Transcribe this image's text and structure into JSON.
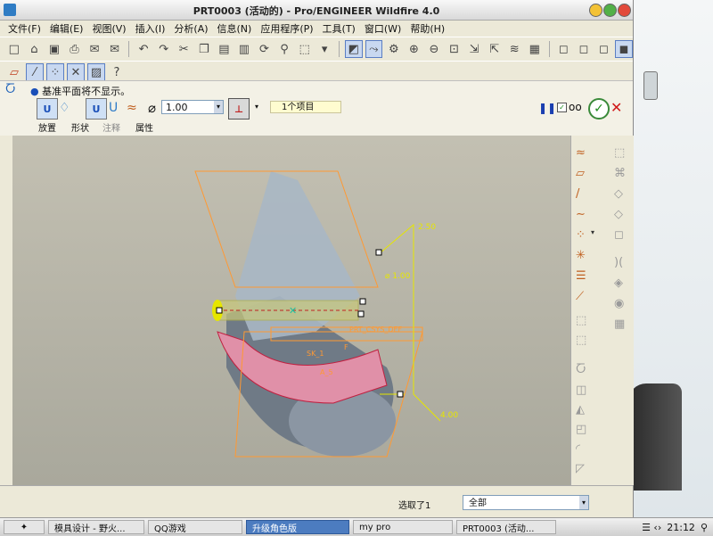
{
  "window": {
    "title": "PRT0003 (活动的) - Pro/ENGINEER Wildfire 4.0"
  },
  "menu": [
    "文件(F)",
    "编辑(E)",
    "视图(V)",
    "插入(I)",
    "分析(A)",
    "信息(N)",
    "应用程序(P)",
    "工具(T)",
    "窗口(W)",
    "帮助(H)"
  ],
  "dashboard": {
    "message": "基准平面将不显示。",
    "diameter": "1.00",
    "items": "1个项目",
    "tabs": [
      "放置",
      "形状",
      "注释",
      "属性"
    ]
  },
  "viewport": {
    "dim1": "2.50",
    "dim2": "⌀ 1.00",
    "dim3": "4.00",
    "label1": "SK_1",
    "label2": "A_5",
    "label3": "PRT_CSYS_DEF",
    "label4": "F"
  },
  "status": {
    "selected": "选取了1",
    "filter": "全部"
  },
  "taskbar": {
    "buttons": [
      "模具设计 - 野火...",
      "QQ游戏",
      "升级角色版",
      "my pro",
      "PRT0003 (活动..."
    ],
    "time": "21:12"
  },
  "colors": {
    "accent_orange": "#ff9933",
    "sketch_yellow": "#e6e600",
    "part_pink": "#e090a8"
  }
}
